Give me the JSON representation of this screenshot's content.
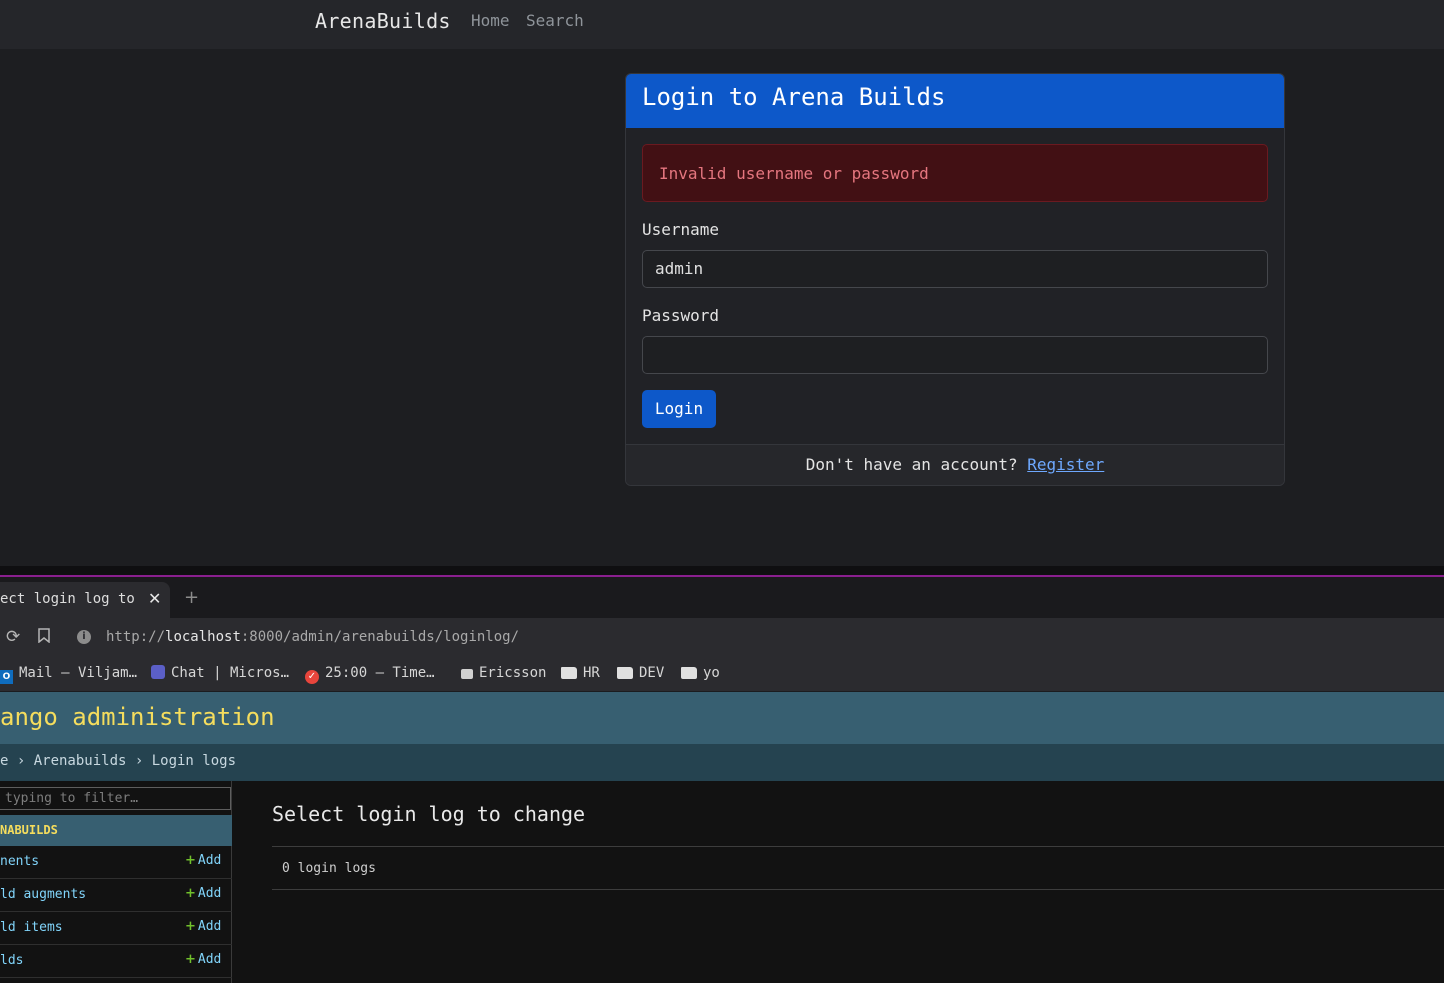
{
  "top_app": {
    "brand": "ArenaBuilds",
    "nav": {
      "home": "Home",
      "search": "Search"
    },
    "login_card": {
      "title": "Login to Arena Builds",
      "alert": "Invalid username or password",
      "username_label": "Username",
      "username_value": "admin",
      "password_label": "Password",
      "password_value": "",
      "login_button": "Login",
      "footer_text": "Don't have an account?",
      "register_link": "Register"
    },
    "colors": {
      "accent": "#0d58c9",
      "alert_bg": "#421014",
      "alert_text": "#e5767f"
    }
  },
  "browser": {
    "tab_title": "ect login log to c",
    "close_glyph": "✕",
    "new_tab_glyph": "+",
    "url_prefix": "http://",
    "url_host": "localhost",
    "url_path": ":8000/admin/arenabuilds/loginlog/",
    "bookmarks": [
      {
        "label": "Mail – Viljam…",
        "icon": "outlook-icon"
      },
      {
        "label": "Chat | Micros…",
        "icon": "teams-icon"
      },
      {
        "label": "25:00 – Time…",
        "icon": "timer-icon"
      },
      {
        "label": "Ericsson",
        "icon": "briefcase-icon"
      },
      {
        "label": "HR",
        "icon": "folder-icon"
      },
      {
        "label": "DEV",
        "icon": "folder-icon"
      },
      {
        "label": "yo",
        "icon": "folder-icon"
      }
    ]
  },
  "django": {
    "site_title": "ango administration",
    "breadcrumbs": "e › Arenabuilds › Login logs",
    "filter_placeholder": " typing to filter…",
    "app_caption": "NABUILDS",
    "models": [
      {
        "name": "nents",
        "add": "Add"
      },
      {
        "name": "ld augments",
        "add": "Add"
      },
      {
        "name": "ld items",
        "add": "Add"
      },
      {
        "name": "lds",
        "add": "Add"
      }
    ],
    "content_title": "Select login log to change",
    "result_count": "0 login logs",
    "colors": {
      "header_bg": "#375f71",
      "title_yellow": "#f5dd5d",
      "link_blue": "#81d4fa",
      "add_green": "#70bf2b"
    }
  }
}
